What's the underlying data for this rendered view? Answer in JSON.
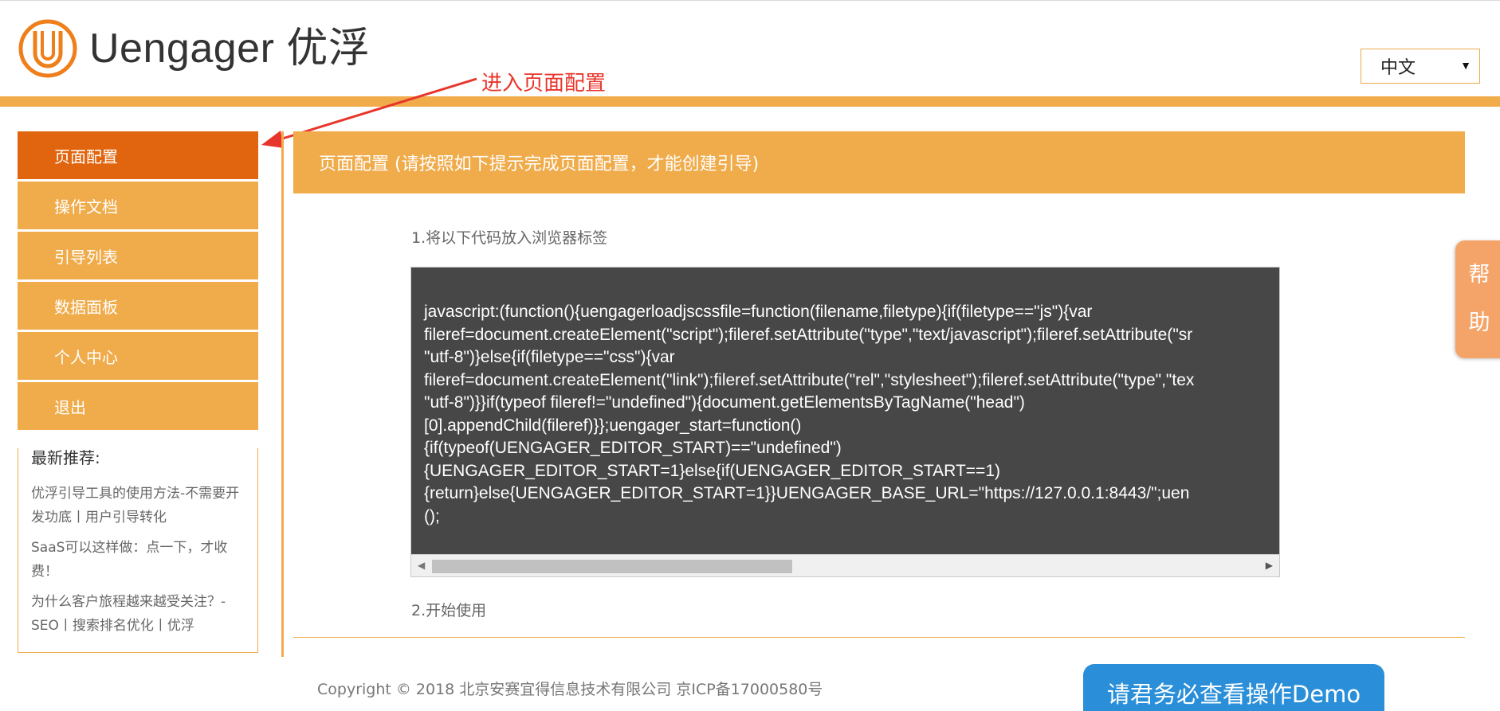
{
  "header": {
    "brand": "Uengager 优浮",
    "language": "中文",
    "annotation": "进入页面配置"
  },
  "sidebar": {
    "items": [
      {
        "label": "页面配置",
        "active": true
      },
      {
        "label": "操作文档"
      },
      {
        "label": "引导列表"
      },
      {
        "label": "数据面板"
      },
      {
        "label": "个人中心"
      },
      {
        "label": "退出"
      }
    ],
    "recommend_title": "最新推荐:",
    "recommend_links": [
      "优浮引导工具的使用方法-不需要开发功底丨用户引导转化",
      "SaaS可以这样做：点一下，才收费！",
      "为什么客户旅程越来越受关注？-SEO丨搜索排名优化丨优浮"
    ]
  },
  "main": {
    "title": "页面配置 (请按照如下提示完成页面配置，才能创建引导)",
    "step1": "1.将以下代码放入浏览器标签",
    "code": "javascript:(function(){uengagerloadjscssfile=function(filename,filetype){if(filetype==\"js\"){var\nfileref=document.createElement(\"script\");fileref.setAttribute(\"type\",\"text/javascript\");fileref.setAttribute(\"sr\n\"utf-8\")}else{if(filetype==\"css\"){var\nfileref=document.createElement(\"link\");fileref.setAttribute(\"rel\",\"stylesheet\");fileref.setAttribute(\"type\",\"tex\n\"utf-8\")}}if(typeof fileref!=\"undefined\"){document.getElementsByTagName(\"head\")\n[0].appendChild(fileref)}};uengager_start=function()\n{if(typeof(UENGAGER_EDITOR_START)==\"undefined\")\n{UENGAGER_EDITOR_START=1}else{if(UENGAGER_EDITOR_START==1)\n{return}else{UENGAGER_EDITOR_START=1}}UENGAGER_BASE_URL=\"https://127.0.0.1:8443/\";uen\n();",
    "step2": "2.开始使用"
  },
  "footer": {
    "copyright": "Copyright © 2018 北京安赛宜得信息技术有限公司 京ICP备17000580号",
    "demo_button": "请君务必查看操作Demo"
  },
  "help_tab": {
    "chars": [
      "帮",
      "助"
    ]
  },
  "colors": {
    "orange": "#f0ab4a",
    "active_orange": "#e0650e",
    "code_bg": "#474747",
    "demo_blue": "#2a8fd8",
    "annotation_red": "#e8352b"
  }
}
